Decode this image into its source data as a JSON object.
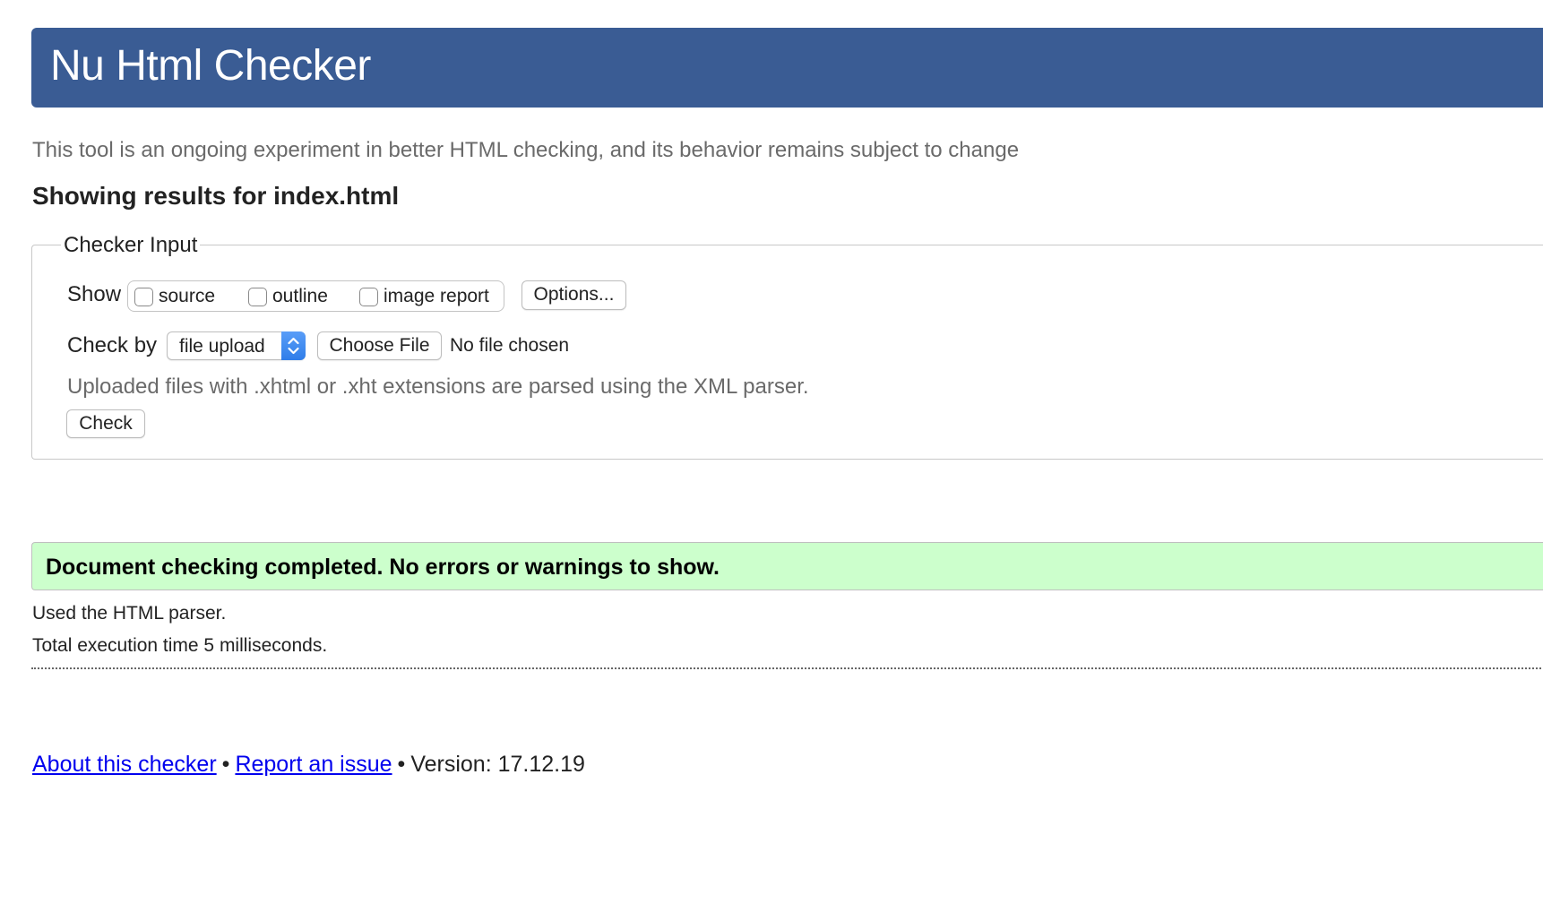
{
  "header": {
    "title": "Nu Html Checker"
  },
  "tagline": "This tool is an ongoing experiment in better HTML checking, and its behavior remains subject to change",
  "results_title": "Showing results for index.html",
  "checker_input": {
    "legend": "Checker Input",
    "show_label": "Show",
    "show_options": [
      {
        "label": "source",
        "checked": false
      },
      {
        "label": "outline",
        "checked": false
      },
      {
        "label": "image report",
        "checked": false
      }
    ],
    "options_button": "Options...",
    "check_by_label": "Check by",
    "check_by_selected": "file upload",
    "choose_file_button": "Choose File",
    "file_status": "No file chosen",
    "note": "Uploaded files with .xhtml or .xht extensions are parsed using the XML parser.",
    "check_button": "Check"
  },
  "result": {
    "message": "Document checking completed. No errors or warnings to show.",
    "color": "#ccffcc"
  },
  "details": {
    "parser": "Used the HTML parser.",
    "time": "Total execution time 5 milliseconds."
  },
  "footer": {
    "about_link": "About this checker",
    "separator": "•",
    "report_link": "Report an issue",
    "version": "Version: 17.12.19"
  },
  "colors": {
    "header_bg": "#3a5c94",
    "link": "#0000ee",
    "select_accent": "#2f7de9"
  },
  "icons": [
    "select-arrows-icon"
  ]
}
